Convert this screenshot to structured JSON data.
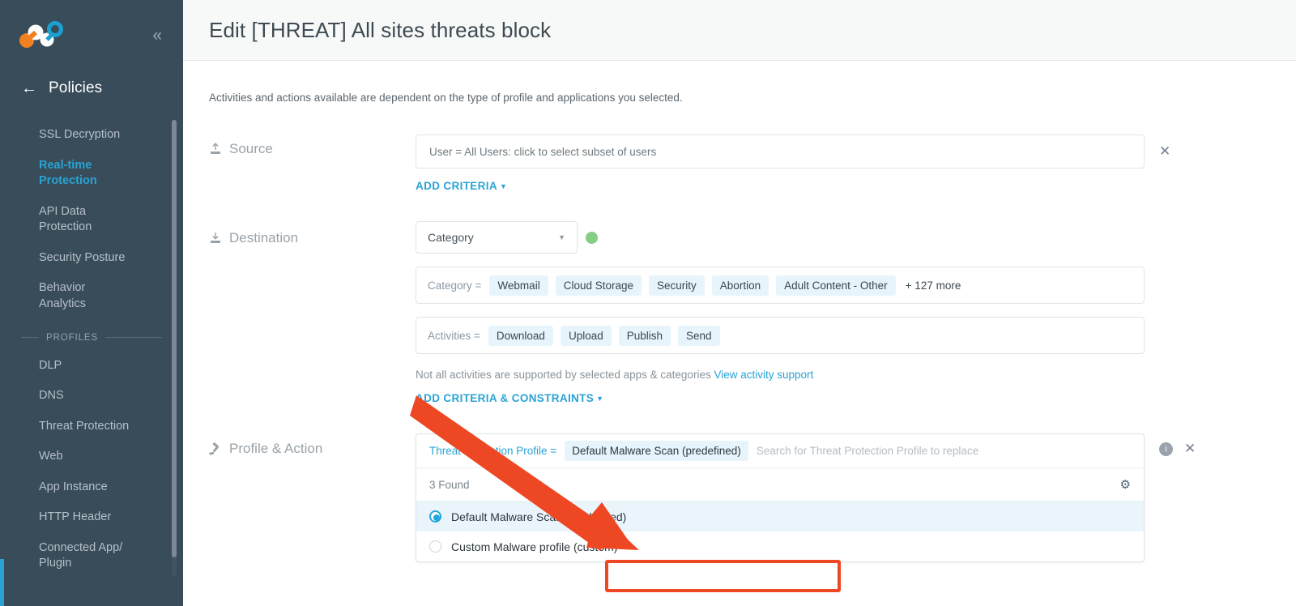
{
  "sidebar": {
    "logo_name": "netskope-logo",
    "collapse_icon": "chevron-double-left-icon",
    "back_icon": "arrow-left-icon",
    "back_title": "Policies",
    "items": [
      {
        "label": "SSL Decryption",
        "active": false
      },
      {
        "label": "Real-time Protection",
        "active": true
      },
      {
        "label": "API Data Protection",
        "active": false
      },
      {
        "label": "Security Posture",
        "active": false
      },
      {
        "label": "Behavior Analytics",
        "active": false
      }
    ],
    "section_label": "PROFILES",
    "profile_items": [
      {
        "label": "DLP"
      },
      {
        "label": "DNS"
      },
      {
        "label": "Threat Protection"
      },
      {
        "label": "Web"
      },
      {
        "label": "App Instance"
      },
      {
        "label": "HTTP Header"
      },
      {
        "label": "Connected App/ Plugin"
      }
    ]
  },
  "header": {
    "title": "Edit [THREAT] All sites threats block"
  },
  "content": {
    "subtitle": "Activities and actions available are dependent on the type of profile and applications you selected."
  },
  "source": {
    "label": "Source",
    "icon": "upload-icon",
    "value": "User = All Users: click to select subset of users",
    "add_criteria_label": "ADD CRITERIA",
    "close_icon": "close-icon"
  },
  "destination": {
    "label": "Destination",
    "icon": "download-icon",
    "selected_type": "Category",
    "status_dot_color": "#86ce85",
    "category_key": "Category =",
    "categories": [
      "Webmail",
      "Cloud Storage",
      "Security",
      "Abortion",
      "Adult Content - Other"
    ],
    "more_label": "+ 127 more",
    "activities_key": "Activities =",
    "activities": [
      "Download",
      "Upload",
      "Publish",
      "Send"
    ],
    "note_text": "Not all activities are supported by selected apps & categories",
    "note_link": "View activity support",
    "add_criteria_label": "ADD CRITERIA & CONSTRAINTS"
  },
  "profile_action": {
    "label": "Profile & Action",
    "icon": "gavel-icon",
    "field_key": "Threat Protection Profile =",
    "selected_chip": "Default Malware Scan (predefined)",
    "search_placeholder": "Search for Threat Protection Profile to replace",
    "found_label": "3 Found",
    "gear_icon": "gear-icon",
    "info_icon": "info-icon",
    "close_icon": "close-icon",
    "options": [
      {
        "label": "Default Malware Scan (predefined)",
        "selected": true
      },
      {
        "label": "Custom Malware profile (custom)",
        "selected": false
      }
    ]
  },
  "annotations": {
    "arrow_color": "#ee4723",
    "highlight_box_color": "#ee4723"
  }
}
